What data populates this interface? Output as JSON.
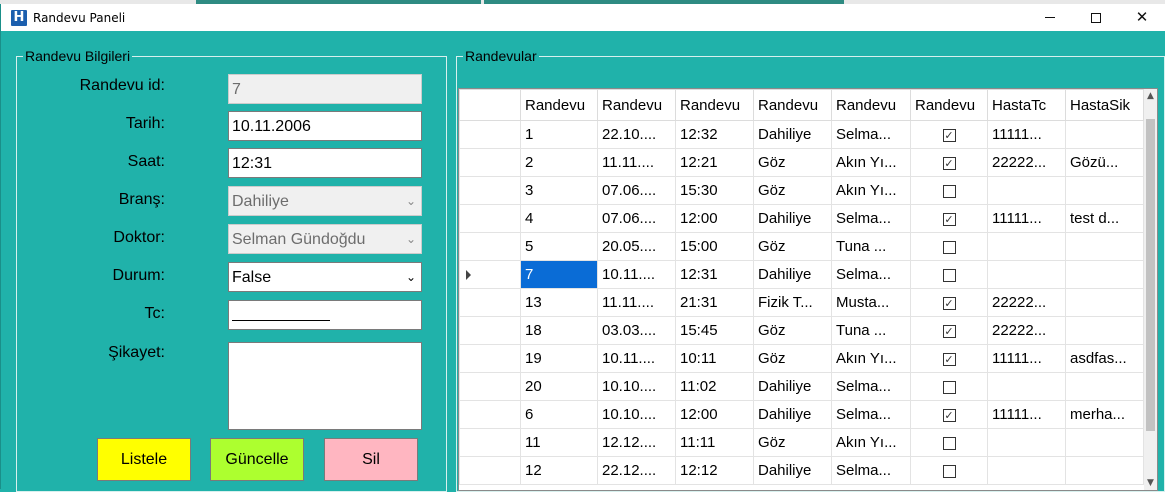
{
  "window": {
    "title": "Randevu Paneli",
    "icon": "H",
    "controls": {
      "minimize": "minimize-icon",
      "maximize": "maximize-icon",
      "close": "✕"
    }
  },
  "info_group": {
    "legend": "Randevu Bilgileri",
    "fields": {
      "id_label": "Randevu id:",
      "id_value": "7",
      "tarih_label": "Tarih:",
      "tarih_value": "10.11.2006",
      "saat_label": "Saat:",
      "saat_value": "12:31",
      "brans_label": "Branş:",
      "brans_value": "Dahiliye",
      "doktor_label": "Doktor:",
      "doktor_value": "Selman Gündoğdu",
      "durum_label": "Durum:",
      "durum_value": "False",
      "tc_label": "Tc:",
      "tc_value": "",
      "sikayet_label": "Şikayet:",
      "sikayet_value": ""
    },
    "buttons": {
      "listele": "Listele",
      "guncelle": "Güncelle",
      "sil": "Sil"
    },
    "button_colors": {
      "listele": "#ffff00",
      "guncelle": "#adff2f",
      "sil": "#ffb6c1"
    }
  },
  "list_group": {
    "legend": "Randevular",
    "columns": [
      "Randevu",
      "Randevu",
      "Randevu",
      "Randevu",
      "Randevu",
      "Randevu",
      "HastaTc",
      "HastaSik"
    ],
    "rows": [
      [
        "1",
        "22.10....",
        "12:32",
        "Dahiliye",
        "Selma...",
        true,
        "11111...",
        ""
      ],
      [
        "2",
        "11.11....",
        "12:21",
        "Göz",
        "Akın Yı...",
        true,
        "22222...",
        "Gözü..."
      ],
      [
        "3",
        "07.06....",
        "15:30",
        "Göz",
        "Akın Yı...",
        false,
        "",
        ""
      ],
      [
        "4",
        "07.06....",
        "12:00",
        "Dahiliye",
        "Selma...",
        true,
        "11111...",
        "test d..."
      ],
      [
        "5",
        "20.05....",
        "15:00",
        "Göz",
        "Tuna ...",
        false,
        "",
        ""
      ],
      [
        "7",
        "10.11....",
        "12:31",
        "Dahiliye",
        "Selma...",
        false,
        "",
        ""
      ],
      [
        "13",
        "11.11....",
        "21:31",
        "Fizik T...",
        "Musta...",
        true,
        "22222...",
        ""
      ],
      [
        "18",
        "03.03....",
        "15:45",
        "Göz",
        "Tuna ...",
        true,
        "22222...",
        ""
      ],
      [
        "19",
        "10.11....",
        "10:11",
        "Göz",
        "Akın Yı...",
        true,
        "11111...",
        "asdfas..."
      ],
      [
        "20",
        "10.10....",
        "11:02",
        "Dahiliye",
        "Selma...",
        false,
        "",
        ""
      ],
      [
        "6",
        "10.10....",
        "12:00",
        "Dahiliye",
        "Selma...",
        true,
        "11111...",
        "merha..."
      ],
      [
        "11",
        "12.12....",
        "11:11",
        "Göz",
        "Akın Yı...",
        false,
        "",
        ""
      ],
      [
        "12",
        "22.12....",
        "12:12",
        "Dahiliye",
        "Selma...",
        false,
        "",
        ""
      ]
    ],
    "selected_row": 5,
    "selection_color": "#0a6cd6"
  },
  "colors": {
    "background": "#20b2aa"
  }
}
